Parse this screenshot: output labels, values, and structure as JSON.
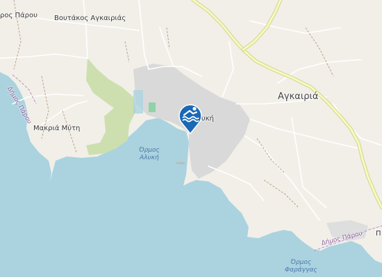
{
  "map": {
    "labels": {
      "paros_road_top": "ρος Πάρου",
      "voutakos": "Βουτάκος Αγκαιριάς",
      "agkairia": "Αγκαιριά",
      "makria_myti": "Μακριά Μύτη",
      "ormos_aliki": "Όρμος\nΑλυκή",
      "aliki": "λυκή",
      "dimos_parou_left": "Δήμος Πάρου",
      "dimos_parou_right": "Δήμος Πάρου",
      "ormos_farangas": "Όρμος\nΦαράγγας",
      "edge_p": "Π"
    },
    "marker": {
      "icon": "swimming-icon",
      "color": "#1b69b6"
    },
    "colors": {
      "land": "#f2efe9",
      "water": "#aad3df",
      "built": "#d9d9d9",
      "park": "#cddfae",
      "major_road": "#f7fabf",
      "road_casing": "#cfd48a"
    }
  }
}
